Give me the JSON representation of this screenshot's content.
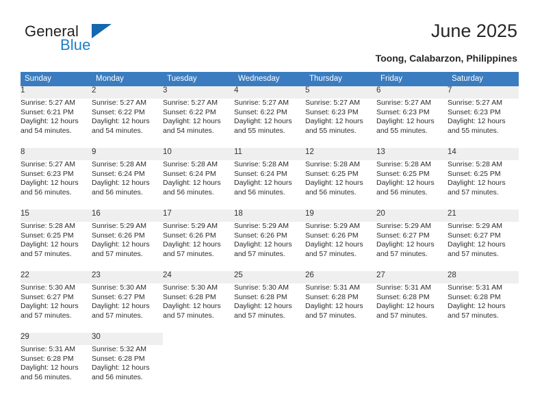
{
  "brand": {
    "name_part1": "General",
    "name_part2": "Blue",
    "triangle_icon": "triangle-icon",
    "accent_color": "#1b7fc4",
    "dark_color": "#231f20"
  },
  "header": {
    "title": "June 2025",
    "location": "Toong, Calabarzon, Philippines"
  },
  "theme": {
    "header_row_color": "#3a7cbf",
    "day_band_color": "#efefef",
    "row_separator_color": "#5b86b4",
    "text_color": "#2b2b2b"
  },
  "weekdays": [
    "Sunday",
    "Monday",
    "Tuesday",
    "Wednesday",
    "Thursday",
    "Friday",
    "Saturday"
  ],
  "weeks": [
    [
      {
        "day": "1",
        "sunrise": "Sunrise: 5:27 AM",
        "sunset": "Sunset: 6:21 PM",
        "daylight1": "Daylight: 12 hours",
        "daylight2": "and 54 minutes."
      },
      {
        "day": "2",
        "sunrise": "Sunrise: 5:27 AM",
        "sunset": "Sunset: 6:22 PM",
        "daylight1": "Daylight: 12 hours",
        "daylight2": "and 54 minutes."
      },
      {
        "day": "3",
        "sunrise": "Sunrise: 5:27 AM",
        "sunset": "Sunset: 6:22 PM",
        "daylight1": "Daylight: 12 hours",
        "daylight2": "and 54 minutes."
      },
      {
        "day": "4",
        "sunrise": "Sunrise: 5:27 AM",
        "sunset": "Sunset: 6:22 PM",
        "daylight1": "Daylight: 12 hours",
        "daylight2": "and 55 minutes."
      },
      {
        "day": "5",
        "sunrise": "Sunrise: 5:27 AM",
        "sunset": "Sunset: 6:23 PM",
        "daylight1": "Daylight: 12 hours",
        "daylight2": "and 55 minutes."
      },
      {
        "day": "6",
        "sunrise": "Sunrise: 5:27 AM",
        "sunset": "Sunset: 6:23 PM",
        "daylight1": "Daylight: 12 hours",
        "daylight2": "and 55 minutes."
      },
      {
        "day": "7",
        "sunrise": "Sunrise: 5:27 AM",
        "sunset": "Sunset: 6:23 PM",
        "daylight1": "Daylight: 12 hours",
        "daylight2": "and 55 minutes."
      }
    ],
    [
      {
        "day": "8",
        "sunrise": "Sunrise: 5:27 AM",
        "sunset": "Sunset: 6:23 PM",
        "daylight1": "Daylight: 12 hours",
        "daylight2": "and 56 minutes."
      },
      {
        "day": "9",
        "sunrise": "Sunrise: 5:28 AM",
        "sunset": "Sunset: 6:24 PM",
        "daylight1": "Daylight: 12 hours",
        "daylight2": "and 56 minutes."
      },
      {
        "day": "10",
        "sunrise": "Sunrise: 5:28 AM",
        "sunset": "Sunset: 6:24 PM",
        "daylight1": "Daylight: 12 hours",
        "daylight2": "and 56 minutes."
      },
      {
        "day": "11",
        "sunrise": "Sunrise: 5:28 AM",
        "sunset": "Sunset: 6:24 PM",
        "daylight1": "Daylight: 12 hours",
        "daylight2": "and 56 minutes."
      },
      {
        "day": "12",
        "sunrise": "Sunrise: 5:28 AM",
        "sunset": "Sunset: 6:25 PM",
        "daylight1": "Daylight: 12 hours",
        "daylight2": "and 56 minutes."
      },
      {
        "day": "13",
        "sunrise": "Sunrise: 5:28 AM",
        "sunset": "Sunset: 6:25 PM",
        "daylight1": "Daylight: 12 hours",
        "daylight2": "and 56 minutes."
      },
      {
        "day": "14",
        "sunrise": "Sunrise: 5:28 AM",
        "sunset": "Sunset: 6:25 PM",
        "daylight1": "Daylight: 12 hours",
        "daylight2": "and 57 minutes."
      }
    ],
    [
      {
        "day": "15",
        "sunrise": "Sunrise: 5:28 AM",
        "sunset": "Sunset: 6:25 PM",
        "daylight1": "Daylight: 12 hours",
        "daylight2": "and 57 minutes."
      },
      {
        "day": "16",
        "sunrise": "Sunrise: 5:29 AM",
        "sunset": "Sunset: 6:26 PM",
        "daylight1": "Daylight: 12 hours",
        "daylight2": "and 57 minutes."
      },
      {
        "day": "17",
        "sunrise": "Sunrise: 5:29 AM",
        "sunset": "Sunset: 6:26 PM",
        "daylight1": "Daylight: 12 hours",
        "daylight2": "and 57 minutes."
      },
      {
        "day": "18",
        "sunrise": "Sunrise: 5:29 AM",
        "sunset": "Sunset: 6:26 PM",
        "daylight1": "Daylight: 12 hours",
        "daylight2": "and 57 minutes."
      },
      {
        "day": "19",
        "sunrise": "Sunrise: 5:29 AM",
        "sunset": "Sunset: 6:26 PM",
        "daylight1": "Daylight: 12 hours",
        "daylight2": "and 57 minutes."
      },
      {
        "day": "20",
        "sunrise": "Sunrise: 5:29 AM",
        "sunset": "Sunset: 6:27 PM",
        "daylight1": "Daylight: 12 hours",
        "daylight2": "and 57 minutes."
      },
      {
        "day": "21",
        "sunrise": "Sunrise: 5:29 AM",
        "sunset": "Sunset: 6:27 PM",
        "daylight1": "Daylight: 12 hours",
        "daylight2": "and 57 minutes."
      }
    ],
    [
      {
        "day": "22",
        "sunrise": "Sunrise: 5:30 AM",
        "sunset": "Sunset: 6:27 PM",
        "daylight1": "Daylight: 12 hours",
        "daylight2": "and 57 minutes."
      },
      {
        "day": "23",
        "sunrise": "Sunrise: 5:30 AM",
        "sunset": "Sunset: 6:27 PM",
        "daylight1": "Daylight: 12 hours",
        "daylight2": "and 57 minutes."
      },
      {
        "day": "24",
        "sunrise": "Sunrise: 5:30 AM",
        "sunset": "Sunset: 6:28 PM",
        "daylight1": "Daylight: 12 hours",
        "daylight2": "and 57 minutes."
      },
      {
        "day": "25",
        "sunrise": "Sunrise: 5:30 AM",
        "sunset": "Sunset: 6:28 PM",
        "daylight1": "Daylight: 12 hours",
        "daylight2": "and 57 minutes."
      },
      {
        "day": "26",
        "sunrise": "Sunrise: 5:31 AM",
        "sunset": "Sunset: 6:28 PM",
        "daylight1": "Daylight: 12 hours",
        "daylight2": "and 57 minutes."
      },
      {
        "day": "27",
        "sunrise": "Sunrise: 5:31 AM",
        "sunset": "Sunset: 6:28 PM",
        "daylight1": "Daylight: 12 hours",
        "daylight2": "and 57 minutes."
      },
      {
        "day": "28",
        "sunrise": "Sunrise: 5:31 AM",
        "sunset": "Sunset: 6:28 PM",
        "daylight1": "Daylight: 12 hours",
        "daylight2": "and 57 minutes."
      }
    ],
    [
      {
        "day": "29",
        "sunrise": "Sunrise: 5:31 AM",
        "sunset": "Sunset: 6:28 PM",
        "daylight1": "Daylight: 12 hours",
        "daylight2": "and 56 minutes."
      },
      {
        "day": "30",
        "sunrise": "Sunrise: 5:32 AM",
        "sunset": "Sunset: 6:28 PM",
        "daylight1": "Daylight: 12 hours",
        "daylight2": "and 56 minutes."
      },
      {
        "day": "",
        "sunrise": "",
        "sunset": "",
        "daylight1": "",
        "daylight2": ""
      },
      {
        "day": "",
        "sunrise": "",
        "sunset": "",
        "daylight1": "",
        "daylight2": ""
      },
      {
        "day": "",
        "sunrise": "",
        "sunset": "",
        "daylight1": "",
        "daylight2": ""
      },
      {
        "day": "",
        "sunrise": "",
        "sunset": "",
        "daylight1": "",
        "daylight2": ""
      },
      {
        "day": "",
        "sunrise": "",
        "sunset": "",
        "daylight1": "",
        "daylight2": ""
      }
    ]
  ]
}
